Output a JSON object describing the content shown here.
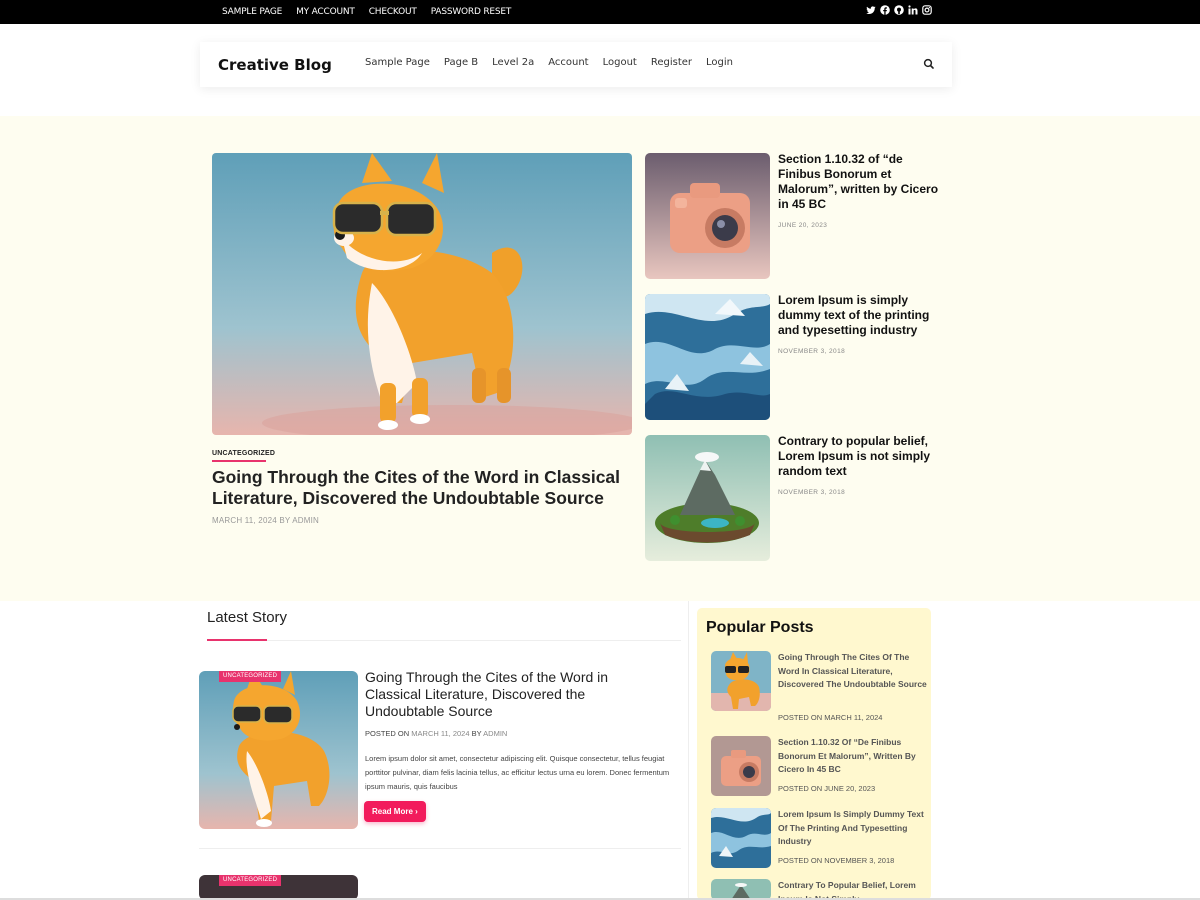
{
  "topbar": {
    "links": [
      "SAMPLE PAGE",
      "MY ACCOUNT",
      "CHECKOUT",
      "PASSWORD RESET"
    ],
    "social_icons": [
      "twitter-icon",
      "facebook-icon",
      "github-icon",
      "linkedin-icon",
      "instagram-icon"
    ]
  },
  "header": {
    "logo": "Creative Blog",
    "nav": [
      "Sample Page",
      "Page B",
      "Level 2a",
      "Account",
      "Logout",
      "Register",
      "Login"
    ],
    "search_icon": "search-icon"
  },
  "hero": {
    "main": {
      "category": "UNCATEGORIZED",
      "title": "Going Through the Cites of the Word in Classical Literature, Discovered the Undoubtable Source",
      "meta": "MARCH 11, 2024 BY ADMIN",
      "image": "shiba-sunglasses"
    },
    "side": [
      {
        "title": "Section 1.10.32 of “de Finibus Bonorum et Malorum”, written by Cicero in 45 BC",
        "date": "JUNE 20, 2023",
        "image": "toy-camera"
      },
      {
        "title": "Lorem Ipsum is simply dummy text of the printing and typesetting industry",
        "date": "NOVEMBER 3, 2018",
        "image": "ice-terrain"
      },
      {
        "title": "Contrary to popular belief, Lorem Ipsum is not simply random text",
        "date": "NOVEMBER 3, 2018",
        "image": "island"
      }
    ]
  },
  "latest": {
    "heading": "Latest Story",
    "posts": [
      {
        "category": "UNCATEGORIZED",
        "title": "Going Through the Cites of the Word in Classical Literature, Discovered the Undoubtable Source",
        "meta_prefix": "POSTED ON",
        "meta_date": "MARCH 11, 2024",
        "meta_by": "BY",
        "meta_author": "ADMIN",
        "excerpt": "Lorem ipsum dolor sit amet, consectetur adipiscing elit. Quisque consectetur, tellus feugiat porttitor pulvinar, diam felis lacinia tellus, ac efficitur lectus urna eu lorem. Donec fermentum ipsum mauris, quis faucibus",
        "read_more": "Read More ›"
      },
      {
        "category": "UNCATEGORIZED"
      }
    ]
  },
  "popular": {
    "heading": "Popular Posts",
    "items": [
      {
        "title": "Going Through The Cites Of The Word In Classical Literature, Discovered The Undoubtable Source",
        "meta": "POSTED ON MARCH 11, 2024",
        "image": "shiba-sunglasses"
      },
      {
        "title": "Section 1.10.32 Of “De Finibus Bonorum Et Malorum”, Written By Cicero In 45 BC",
        "meta": "POSTED ON JUNE 20, 2023",
        "image": "toy-camera"
      },
      {
        "title": "Lorem Ipsum Is Simply Dummy Text Of The Printing And Typesetting Industry",
        "meta": "POSTED ON NOVEMBER 3, 2018",
        "image": "ice-terrain"
      },
      {
        "title": "Contrary To Popular Belief, Lorem Ipsum Is Not Simply",
        "meta": "",
        "image": "island"
      }
    ]
  },
  "colors": {
    "accent": "#e8336d",
    "button": "#f21b5c",
    "hero_bg": "#fefdf0",
    "popular_bg": "#fff8cf"
  }
}
